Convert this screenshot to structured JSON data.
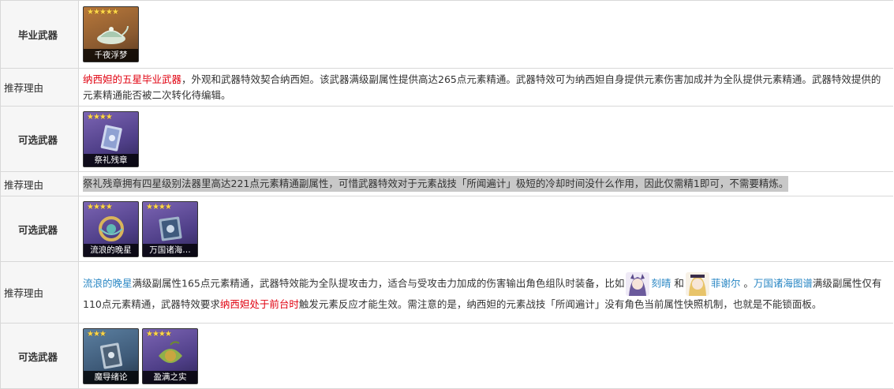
{
  "rows": [
    {
      "label": "毕业武器",
      "weapons": [
        {
          "name": "千夜浮梦",
          "stars": "★★★★★"
        }
      ]
    },
    {
      "label": "推荐理由",
      "parts": [
        {
          "t": "纳西妲的五星毕业武器",
          "c": "red"
        },
        {
          "t": "，外观和武器特效契合纳西妲。该武器满级副属性提供高达265点元素精通。武器特效可为纳西妲自身提供元素伤害加成并为全队提供元素精通。武器特效提供的元素精通能否被二次转化待编辑。"
        }
      ]
    },
    {
      "label": "可选武器",
      "weapons": [
        {
          "name": "祭礼残章",
          "stars": "★★★★"
        }
      ]
    },
    {
      "label": "推荐理由",
      "text": "祭礼残章拥有四星级别法器里高达221点元素精通副属性，可惜武器特效对于元素战技「所闻遍计」极短的冷却时间没什么作用，因此仅需精1即可，不需要精炼。"
    },
    {
      "label": "可选武器",
      "weapons": [
        {
          "name": "流浪的晚星",
          "stars": "★★★★"
        },
        {
          "name": "万国诸海…",
          "stars": "★★★★"
        }
      ]
    },
    {
      "label": "推荐理由",
      "parts": [
        {
          "t": "流浪的晚星",
          "c": "blue"
        },
        {
          "t": "满级副属性165点元素精通，武器特效能为全队提攻击力，适合与受攻击力加成的伤害输出角色组队时装备，比如"
        },
        {
          "t": "avatar-keqing",
          "avatar": "k"
        },
        {
          "t": "刻晴",
          "c": "blue"
        },
        {
          "t": " 和"
        },
        {
          "t": "avatar-fischl",
          "avatar": "f"
        },
        {
          "t": "菲谢尔",
          "c": "blue"
        },
        {
          "t": " 。"
        },
        {
          "t": "万国诸海图谱",
          "c": "blue"
        },
        {
          "t": "满级副属性仅有110点元素精通，武器特效要求"
        },
        {
          "t": "纳西妲处于前台时",
          "c": "red"
        },
        {
          "t": "触发元素反应才能生效。需注意的是，纳西妲的元素战技「所闻遍计」没有角色当前属性快照机制，也就是不能锁面板。"
        }
      ]
    },
    {
      "label": "可选武器",
      "weapons": [
        {
          "name": "魔导绪论",
          "stars": "★★★"
        },
        {
          "name": "盈满之实",
          "stars": "★★★★"
        }
      ]
    }
  ]
}
